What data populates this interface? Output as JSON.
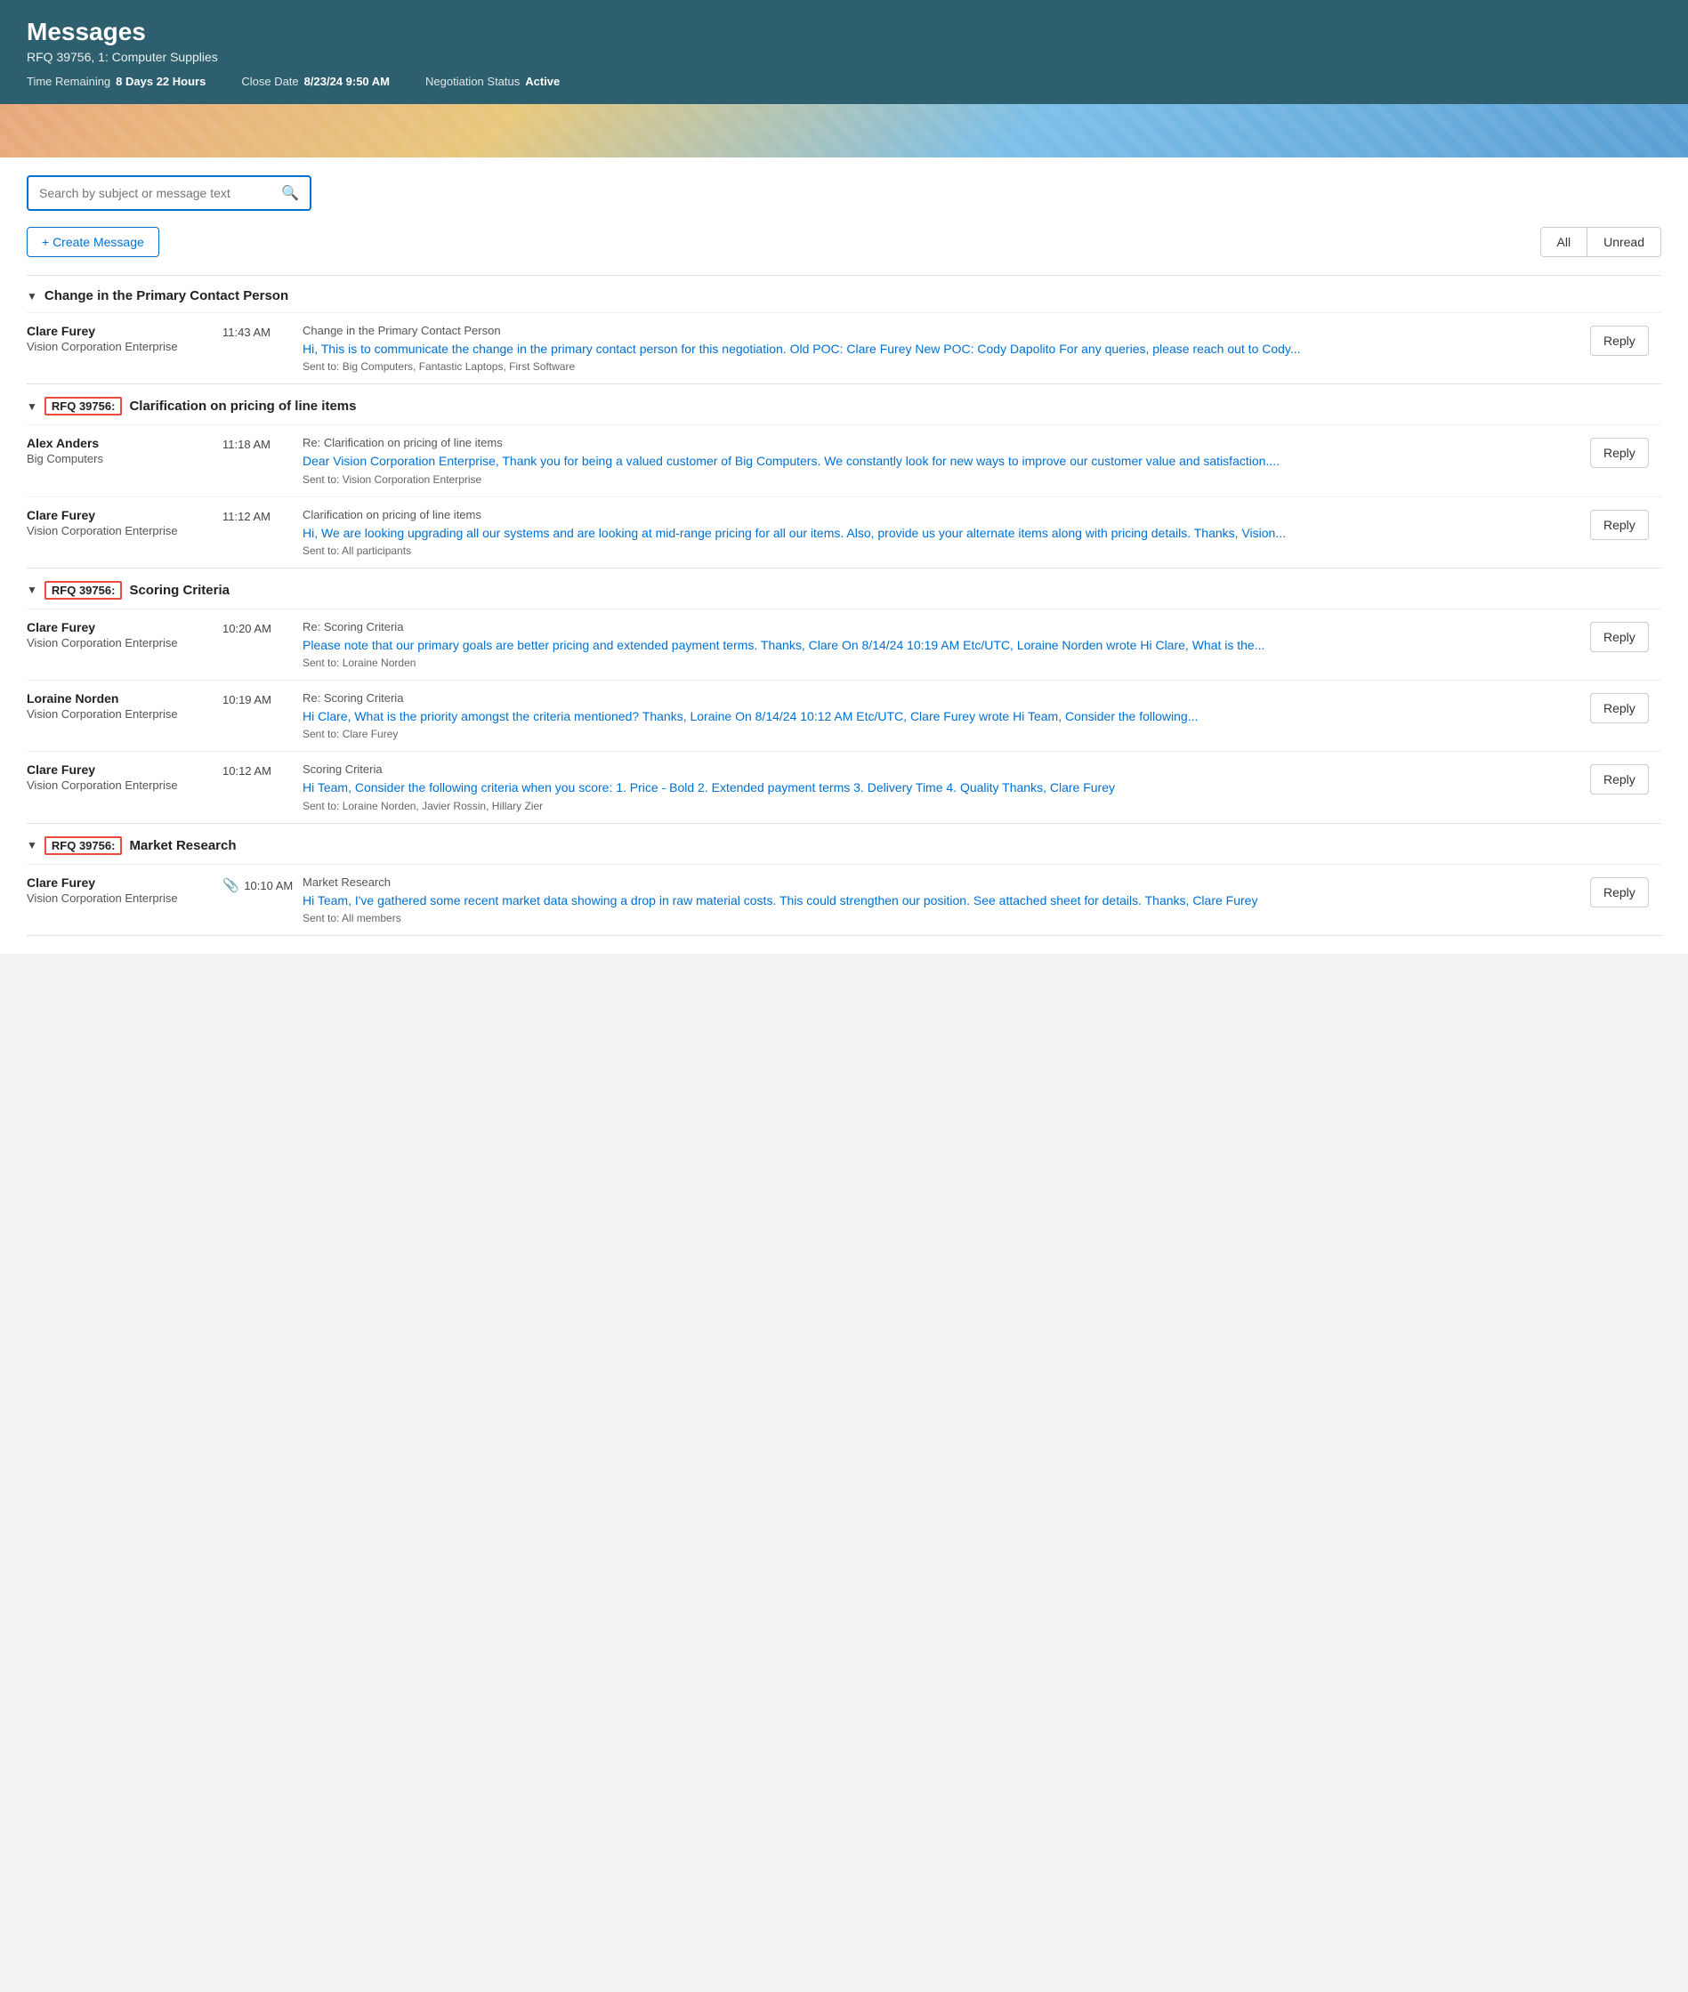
{
  "header": {
    "title": "Messages",
    "subtitle": "RFQ 39756, 1: Computer Supplies",
    "meta": [
      {
        "label": "Time Remaining",
        "value": "8 Days 22 Hours"
      },
      {
        "label": "Close Date",
        "value": "8/23/24 9:50 AM"
      },
      {
        "label": "Negotiation Status",
        "value": "Active"
      }
    ]
  },
  "search": {
    "placeholder": "Search by subject or message text"
  },
  "toolbar": {
    "create_label": "+ Create Message",
    "filter_all": "All",
    "filter_unread": "Unread"
  },
  "threads": [
    {
      "id": "thread-1",
      "title": "Change in the Primary Contact Person",
      "rfq_badge": null,
      "messages": [
        {
          "sender_name": "Clare Furey",
          "sender_org": "Vision Corporation Enterprise",
          "time": "11:43 AM",
          "subject": "Change in the Primary Contact Person",
          "preview": "Hi, This is to communicate the change in the primary contact person for this negotiation. Old POC: Clare Furey New POC: Cody Dapolito For any queries, please reach out to Cody...",
          "sent_to": "Sent to: Big Computers, Fantastic Laptops, First Software",
          "has_attachment": false
        }
      ]
    },
    {
      "id": "thread-2",
      "title": "Clarification on pricing of line items",
      "rfq_badge": "RFQ 39756:",
      "messages": [
        {
          "sender_name": "Alex Anders",
          "sender_org": "Big Computers",
          "time": "11:18 AM",
          "subject": "Re: Clarification on pricing of line items",
          "preview": "Dear Vision Corporation Enterprise, Thank you for being a valued customer of Big Computers. We constantly look for new ways to improve our customer value and satisfaction....",
          "sent_to": "Sent to: Vision Corporation Enterprise",
          "has_attachment": false
        },
        {
          "sender_name": "Clare Furey",
          "sender_org": "Vision Corporation Enterprise",
          "time": "11:12 AM",
          "subject": "Clarification on pricing of line items",
          "preview": "Hi, We are looking upgrading all our systems and are looking at mid-range pricing for all our items. Also, provide us your alternate items along with pricing details. Thanks, Vision...",
          "sent_to": "Sent to: All participants",
          "has_attachment": false
        }
      ]
    },
    {
      "id": "thread-3",
      "title": "Scoring Criteria",
      "rfq_badge": "RFQ 39756:",
      "messages": [
        {
          "sender_name": "Clare Furey",
          "sender_org": "Vision Corporation Enterprise",
          "time": "10:20 AM",
          "subject": "Re: Scoring Criteria",
          "preview": "Please note that our primary goals are better pricing and extended payment terms. Thanks, Clare On 8/14/24 10:19 AM Etc/UTC, Loraine Norden wrote Hi Clare, What is the...",
          "sent_to": "Sent to: Loraine Norden",
          "has_attachment": false
        },
        {
          "sender_name": "Loraine Norden",
          "sender_org": "Vision Corporation Enterprise",
          "time": "10:19 AM",
          "subject": "Re: Scoring Criteria",
          "preview": "Hi Clare, What is the priority amongst the criteria mentioned? Thanks, Loraine On 8/14/24 10:12 AM Etc/UTC, Clare Furey wrote Hi Team, Consider the following...",
          "sent_to": "Sent to: Clare Furey",
          "has_attachment": false
        },
        {
          "sender_name": "Clare Furey",
          "sender_org": "Vision Corporation Enterprise",
          "time": "10:12 AM",
          "subject": "Scoring Criteria",
          "preview": "Hi Team, Consider the following criteria when you score: 1. Price - Bold 2. Extended payment terms 3. Delivery Time 4. Quality Thanks, Clare Furey",
          "sent_to": "Sent to: Loraine Norden, Javier Rossin, Hillary Zier",
          "has_attachment": false
        }
      ]
    },
    {
      "id": "thread-4",
      "title": "Market Research",
      "rfq_badge": "RFQ 39756:",
      "messages": [
        {
          "sender_name": "Clare Furey",
          "sender_org": "Vision Corporation Enterprise",
          "time": "10:10 AM",
          "subject": "Market Research",
          "preview": "Hi Team, I've gathered some recent market data showing a drop in raw material costs. This could strengthen our position. See attached sheet for details. Thanks, Clare Furey",
          "sent_to": "Sent to: All members",
          "has_attachment": true
        }
      ]
    }
  ]
}
